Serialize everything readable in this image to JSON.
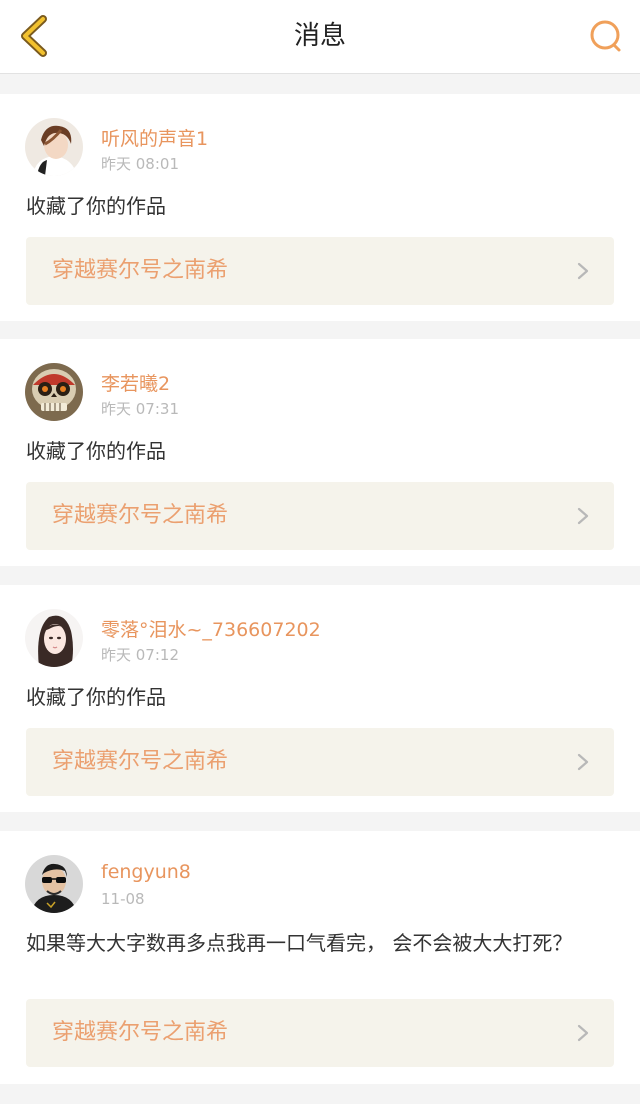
{
  "header": {
    "title": "消息",
    "back_icon": "chevron-left-icon",
    "search_icon": "search-icon",
    "accent_color": "#f0a05a"
  },
  "notifications": [
    {
      "username": "听风的声音1",
      "time": "昨天 08:01",
      "message": "收藏了你的作品",
      "work_title": "穿越赛尔号之南希",
      "avatar": "avatar-boy-photo"
    },
    {
      "username": "李若曦2",
      "time": "昨天 07:31",
      "message": "收藏了你的作品",
      "work_title": "穿越赛尔号之南希",
      "avatar": "avatar-skull-mask"
    },
    {
      "username": "零落°泪水~_736607202",
      "time": "昨天 07:12",
      "message": "收藏了你的作品",
      "work_title": "穿越赛尔号之南希",
      "avatar": "avatar-girl-drawing"
    },
    {
      "username": "fengyun8",
      "time": "11-08",
      "message": "如果等大大字数再多点我再一口气看完， 会不会被大大打死？",
      "work_title": "穿越赛尔号之南希",
      "avatar": "avatar-man-sunglasses"
    }
  ],
  "colors": {
    "username": "#e8955e",
    "work_title": "#eba070",
    "work_bg": "#f5f3eb",
    "page_bg": "#f4f4f4"
  }
}
